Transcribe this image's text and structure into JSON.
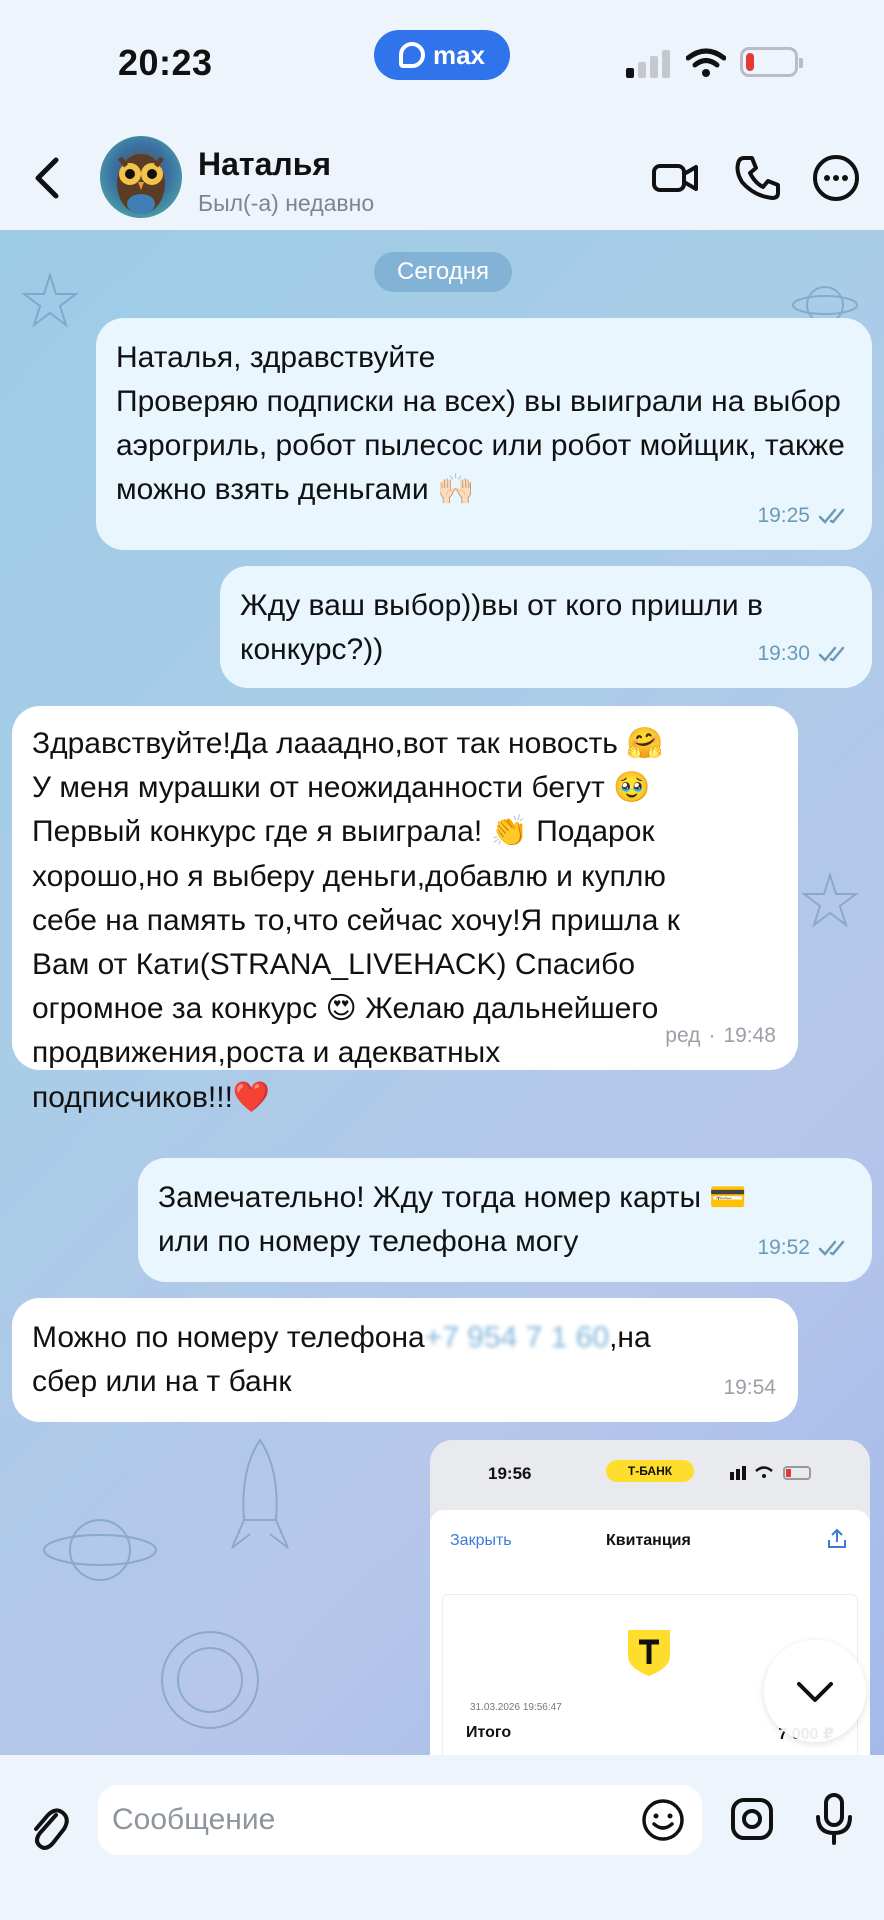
{
  "status_bar": {
    "time": "20:23",
    "app_badge": "max"
  },
  "header": {
    "contact_name": "Наталья",
    "contact_status": "Был(-а) недавно"
  },
  "chat": {
    "date_label": "Сегодня",
    "messages": [
      {
        "direction": "outgoing",
        "text": "Наталья, здравствуйте\nПроверяю подписки на всех) вы выиграли на выбор аэрогриль, робот пылесос или робот мойщик, также можно взять деньгами",
        "emoji": "🙌🏻",
        "time": "19:25",
        "status": "read"
      },
      {
        "direction": "outgoing",
        "text": "Жду ваш выбор))вы от кого пришли в конкурс?))",
        "time": "19:30",
        "status": "read"
      },
      {
        "direction": "incoming",
        "text_l1": "Здравствуйте!Да лааадно,вот так новость",
        "emoji_l1": "🤗",
        "text_l2": "У меня мурашки от неожиданности бегут",
        "emoji_l2": "🥹",
        "text_l3": "Первый конкурс где я выиграла!",
        "emoji_l3": "👏",
        "text_l3b": " Подарок",
        "text_l4": "хорошо,но я выберу деньги,добавлю и куплю",
        "text_l5": "себе на память то,что сейчас хочу!Я пришла к",
        "text_l6": "Вам от Кати(STRANA_LIVEHACK) Спасибо",
        "text_l7": "огромное за конкурс",
        "emoji_l7": "😍",
        "text_l7b": " Желаю дальнейшего",
        "text_l8": "продвижения,роста и адекватных",
        "text_l9": "подписчиков!!!",
        "emoji_l9": "❤️",
        "edited_label": "ред",
        "time": "19:48"
      },
      {
        "direction": "outgoing",
        "text_l1": "Замечательно! Жду тогда номер карты",
        "emoji_l1": "💳",
        "text_l2": "или по номеру телефона  могу",
        "time": "19:52",
        "status": "read"
      },
      {
        "direction": "incoming",
        "text_a": "Можно по номеру телефона",
        "hidden_number": "+7 954 7 1 60",
        "text_b": ",на",
        "text_l2": "сбер или на т банк",
        "time": "19:54"
      }
    ],
    "receipt": {
      "time": "19:56",
      "bank": "Т-БАНК",
      "close_label": "Закрыть",
      "title": "Квитанция",
      "datetime": "31.03.2026 19:56:47",
      "total_label": "Итого",
      "amount": "7 000 ₽"
    }
  },
  "composer": {
    "placeholder": "Сообщение"
  },
  "colors": {
    "accent": "#2f74ea",
    "outgoing_bubble": "#e9f6fe",
    "incoming_bubble": "#ffffff",
    "tbank_yellow": "#ffdd2d"
  }
}
